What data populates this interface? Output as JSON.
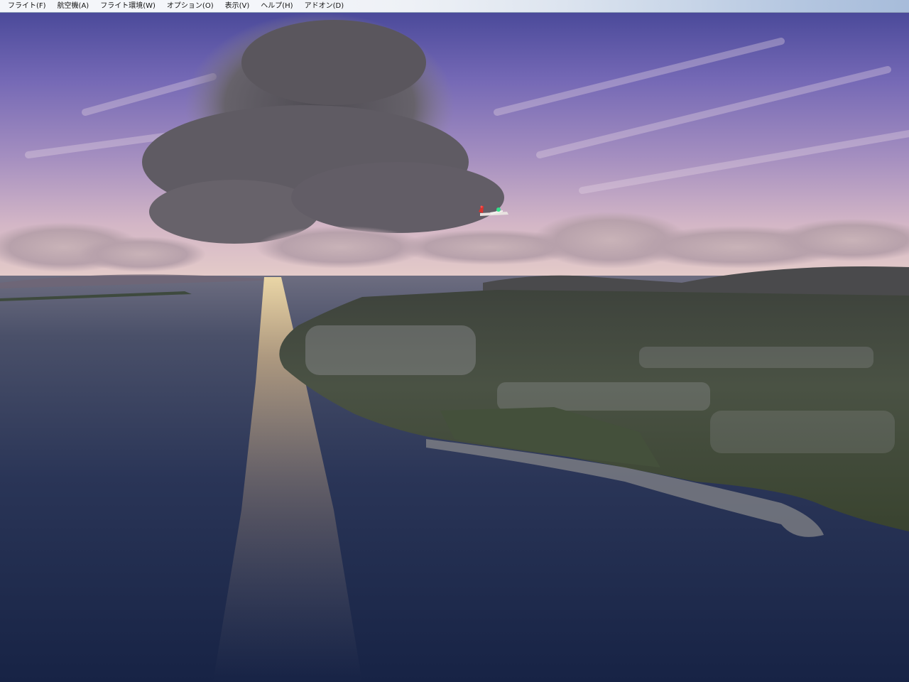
{
  "menubar": {
    "items": [
      {
        "label": "フライト(F)"
      },
      {
        "label": "航空機(A)"
      },
      {
        "label": "フライト環境(W)"
      },
      {
        "label": "オプション(O)"
      },
      {
        "label": "表示(V)"
      },
      {
        "label": "ヘルプ(H)"
      },
      {
        "label": "アドオン(D)"
      }
    ]
  },
  "scene": {
    "colors": {
      "sky_top": "#5f56a6",
      "sky_mid": "#8a7bbd",
      "sky_horizon": "#d7b9c4",
      "cloud_dark": "#5e5a62",
      "sea_far": "#5a5e73",
      "sea_near": "#1c2a4a",
      "land": "#3c4638",
      "sun_glint": "#e9cf9a"
    }
  }
}
